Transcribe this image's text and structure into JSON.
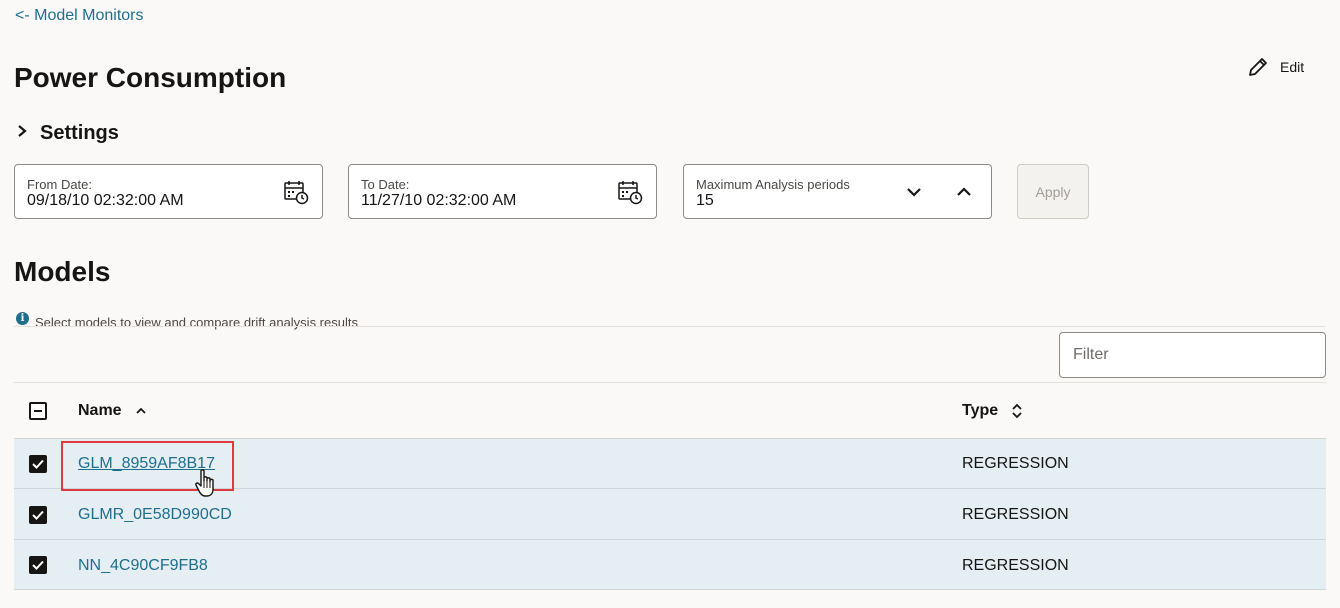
{
  "nav": {
    "back_link": "<- Model Monitors"
  },
  "header": {
    "title": "Power Consumption",
    "edit_label": "Edit"
  },
  "settings": {
    "label": "Settings",
    "from_date": {
      "label": "From Date:",
      "value": "09/18/10 02:32:00 AM"
    },
    "to_date": {
      "label": "To Date:",
      "value": "11/27/10 02:32:00 AM"
    },
    "max_periods": {
      "label": "Maximum Analysis periods",
      "value": "15"
    },
    "apply_label": "Apply"
  },
  "models": {
    "title": "Models",
    "info_text": "Select models to view and compare drift analysis results",
    "filter_placeholder": "Filter",
    "columns": {
      "name": "Name",
      "type": "Type"
    },
    "rows": [
      {
        "name": "GLM_8959AF8B17",
        "type": "REGRESSION",
        "checked": true
      },
      {
        "name": "GLMR_0E58D990CD",
        "type": "REGRESSION",
        "checked": true
      },
      {
        "name": "NN_4C90CF9FB8",
        "type": "REGRESSION",
        "checked": true
      }
    ]
  },
  "colors": {
    "link": "#1e6f8c",
    "row_selected": "#e4eef3",
    "highlight": "#e0393e"
  },
  "icons": [
    "pencil-icon",
    "chevron-right-icon",
    "calendar-clock-icon",
    "chevron-down-icon",
    "chevron-up-icon",
    "info-icon",
    "sort-ascending-icon",
    "sort-unsorted-icon",
    "checkbox-checked-icon",
    "hand-pointer-cursor"
  ]
}
